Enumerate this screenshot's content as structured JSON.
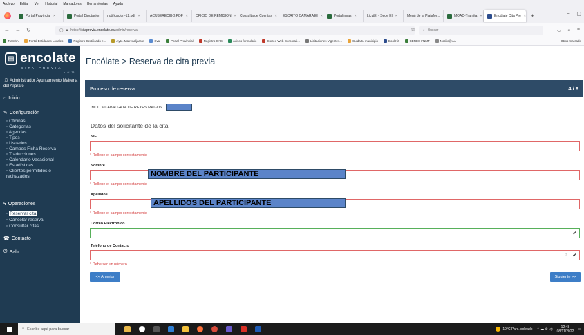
{
  "menubar": [
    "Archivo",
    "Editar",
    "Ver",
    "Historial",
    "Marcadores",
    "Herramientas",
    "Ayuda"
  ],
  "tabs": [
    {
      "label": "Portal Provincial"
    },
    {
      "label": "Portal Diputacion"
    },
    {
      "label": "notificacion-12.pdf"
    },
    {
      "label": "ACUSERECIBO.PDF"
    },
    {
      "label": "OFICIO DE REMISION"
    },
    {
      "label": "Consulta de Cuentas"
    },
    {
      "label": "ESCRITO CAMARA EI"
    },
    {
      "label": "Portafirmas"
    },
    {
      "label": "LicytEl - Sede El"
    },
    {
      "label": "Menú de la Platafor..."
    },
    {
      "label": "MOAD-Tramita"
    },
    {
      "label": "Encólate Cita Pre"
    }
  ],
  "address": {
    "prefix": "https://",
    "host": "citaprevia.encolate.es",
    "path": "/admin/reserva"
  },
  "search_placeholder": "Buscar",
  "bookmarks": [
    "TramitA",
    "Portal Entidades Locales",
    "Registro Certificado e...",
    "Ayto. Mairenaljarafe",
    "Sval",
    "Portal Provincial",
    "Registro SAC",
    "Avisos formulario",
    "Correo Web Corporati...",
    "Licitaciones Vigentes...",
    "Cuida tu municipio",
    "BookKit",
    "CERES FNMT",
    "Notific@AA"
  ],
  "bookmarks_other": "Otros marcado",
  "sidebar": {
    "logo": "encolate",
    "logo_sub": "CITA PREVIA",
    "version": "v 1.0.1.76",
    "user": "Administrador Ayuntamiento Mairena del Aljarafe",
    "inicio": "Inicio",
    "configuracion": "Configuración",
    "config_items": [
      "Oficinas",
      "Categorías",
      "Agendas",
      "Tipos",
      "Usuarios",
      "Campos Ficha Reserva",
      "Traducciones",
      "Calendario Vacacional",
      "Estadísticas",
      "Clientes permitidos o rechazados"
    ],
    "operaciones": "Operaciones",
    "op_items": [
      "Reservar cita",
      "Cancelar reserva",
      "Consultar citas"
    ],
    "contacto": "Contacto",
    "salir": "Salir"
  },
  "main": {
    "title": "Encólate > Reserva de cita previa",
    "panel_title": "Proceso de reserva",
    "step": "4 / 6",
    "breadcrumb": "IMDC > CABALGATA DE REYES MAGOS",
    "section_title": "Datos del solicitante de la cita",
    "fields": {
      "nif": {
        "label": "NIF",
        "error": "* Rellene el campo correctamente"
      },
      "nombre": {
        "label": "Nombre",
        "error": "* Rellene el campo correctamente",
        "overlay": "NOMBRE DEL PARTICIPANTE"
      },
      "apellidos": {
        "label": "Apellidos",
        "error": "* Rellene el campo correctamente",
        "overlay": "APELLIDOS DEL PARTICIPANTE"
      },
      "correo": {
        "label": "Correo Electrónico"
      },
      "telefono": {
        "label": "Teléfono de Contacto",
        "error": "* Debe ser un número"
      }
    },
    "btn_prev": "<< Anterior",
    "btn_next": "Siguiente >>"
  },
  "taskbar": {
    "search": "Escribe aquí para buscar",
    "weather": "19°C Parc. soleado",
    "time": "12:48",
    "date": "08/11/2022"
  },
  "colors": {
    "sidebar": "#1f3b52",
    "panel": "#2e4b67",
    "button": "#3d7ec7",
    "error": "#d33a3a",
    "overlay": "#5b84c9"
  }
}
